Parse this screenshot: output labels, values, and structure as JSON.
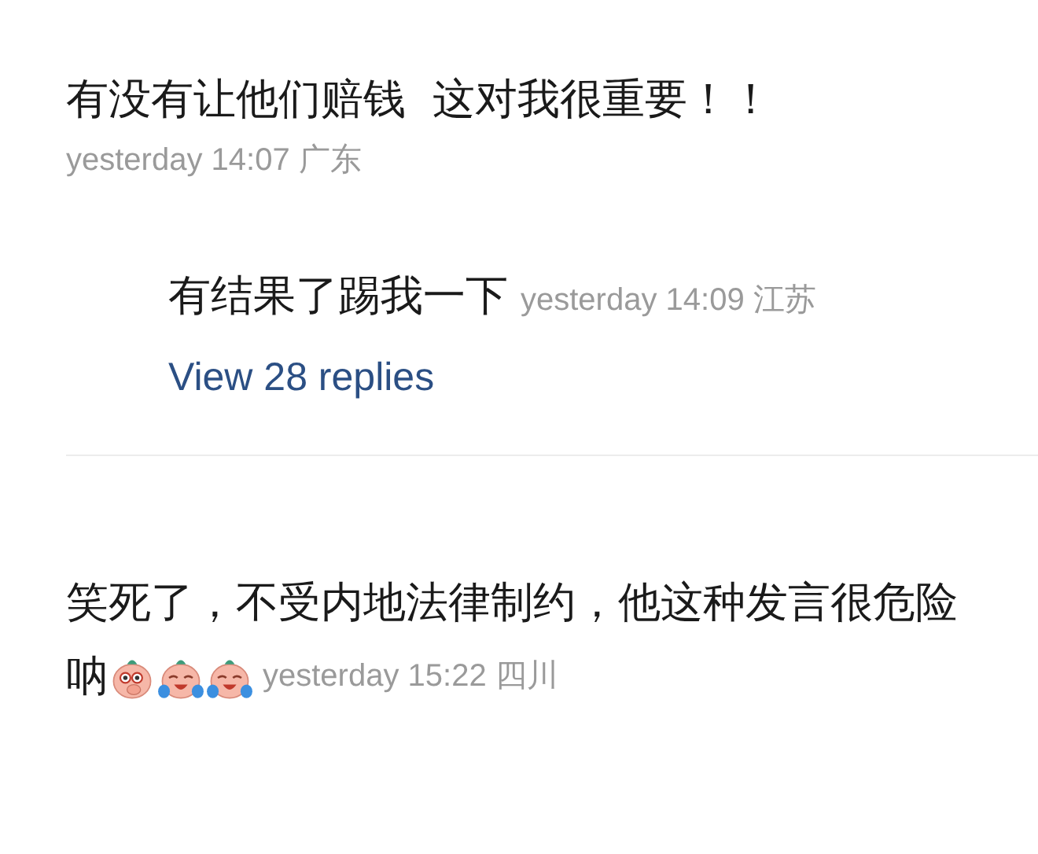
{
  "comments": [
    {
      "lines": [
        "有没有让他们赔钱  这对我很重要！！"
      ],
      "time": "yesterday 14:07",
      "location": "广东",
      "replies": [
        {
          "text": "有结果了踢我一下",
          "time": "yesterday 14:09",
          "location": "江苏"
        }
      ],
      "more_replies": "View 28 replies"
    },
    {
      "lines": [
        "笑死了，不受内地法律制约，他这种发言很危险",
        "呐"
      ],
      "emojis": [
        {
          "kind": "cover-mouth"
        },
        {
          "kind": "crying"
        },
        {
          "kind": "crying"
        }
      ],
      "time": "yesterday 15:22",
      "location": "四川"
    }
  ]
}
